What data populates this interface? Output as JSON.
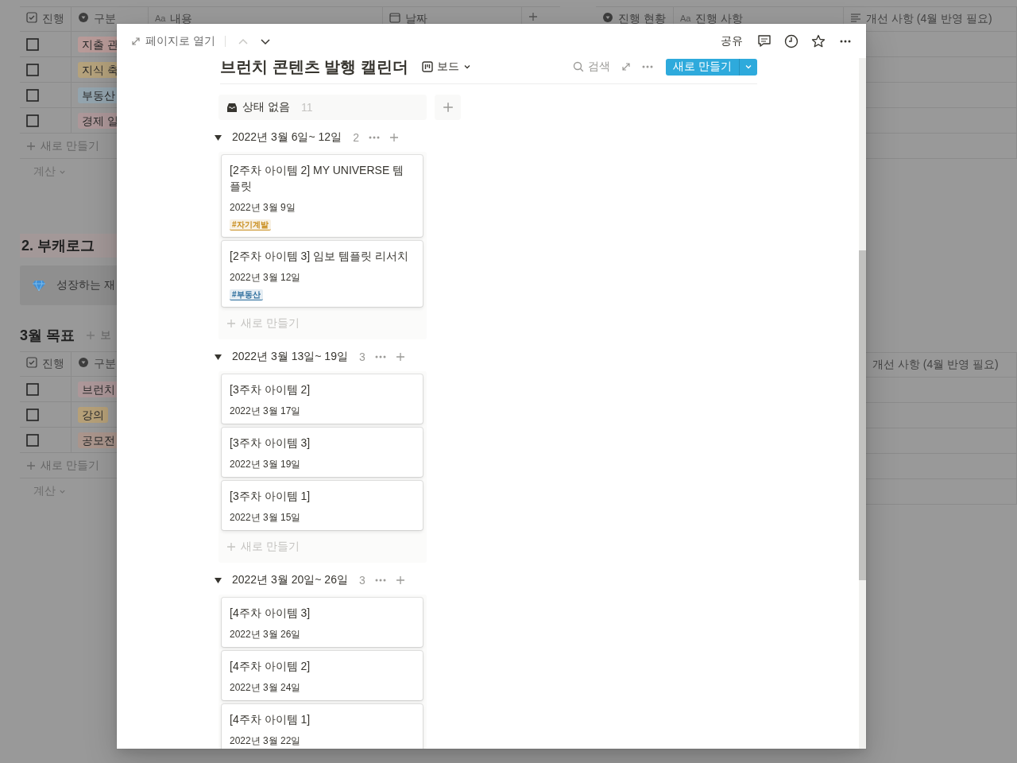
{
  "background": {
    "table_1": {
      "columns": [
        {
          "label": "진행",
          "kind": "checkbox"
        },
        {
          "label": "구분",
          "kind": "select"
        },
        {
          "label": "내용",
          "kind": "title",
          "icon_text": "Aa"
        },
        {
          "label": "날짜",
          "kind": "date"
        }
      ],
      "rows": [
        {
          "checked": false,
          "tag": "지출 관",
          "color": "#b89a98"
        },
        {
          "checked": false,
          "tag": "지식 축",
          "color": "#b5a27c"
        },
        {
          "checked": false,
          "tag": "부동산",
          "color": "#93a4ae"
        },
        {
          "checked": false,
          "tag": "경제 일",
          "color": "#ad9799"
        }
      ],
      "new_row": "새로 만들기",
      "calculate": "계산"
    },
    "heading": "2. 부캐로그",
    "callout": "성장하는 재",
    "table_2_title": "3월 목표",
    "add_view": "보",
    "table_2": {
      "columns": [
        {
          "label": "진행",
          "kind": "checkbox"
        },
        {
          "label": "구분",
          "kind": "select"
        }
      ],
      "rows": [
        {
          "checked": false,
          "tag": "브런치",
          "color": "#ad9799"
        },
        {
          "checked": false,
          "tag": "강의",
          "color": "#b6a078"
        },
        {
          "checked": false,
          "tag": "공모전",
          "color": "#aa958c"
        }
      ],
      "new_row": "새로 만들기",
      "calculate": "계산"
    },
    "table_3": {
      "columns": [
        {
          "label": "진행 현황",
          "kind": "select"
        },
        {
          "label": "진행 사항",
          "kind": "title",
          "icon_text": "Aa"
        },
        {
          "label": "개선 사항 (4월 반영 필요)",
          "kind": "text"
        }
      ]
    },
    "table_4": {
      "columns": [
        {
          "label": "개선 사항 (4월 반영 필요)"
        }
      ]
    }
  },
  "peek": {
    "open_as_page": "페이지로 열기",
    "prev_disabled": true,
    "next_disabled": false,
    "share": "공유",
    "title": "브런치 콘텐츠 발행 캘린더",
    "view": "보드",
    "search": "검색",
    "new_button": "새로 만들기",
    "no_status": {
      "label": "상태 없음",
      "count": "11"
    },
    "groups": [
      {
        "label": "2022년 3월 6일~ 12일",
        "count": "2",
        "expanded": true,
        "new_label": "새로 만들기",
        "cards": [
          {
            "title": "[2주차 아이템 2] MY UNIVERSE 템플릿",
            "date": "2022년 3월 9일",
            "tag": {
              "label": "#자기계발",
              "color": "#c98e1f"
            }
          },
          {
            "title": "[2주차 아이템 3] 임보 템플릿 리서치",
            "date": "2022년 3월 12일",
            "tag": {
              "label": "#부동산",
              "color": "#2b6d9c"
            }
          }
        ]
      },
      {
        "label": "2022년 3월 13일~ 19일",
        "count": "3",
        "expanded": true,
        "new_label": "새로 만들기",
        "cards": [
          {
            "title": "[3주차 아이템 2]",
            "date": "2022년 3월 17일"
          },
          {
            "title": "[3주차 아이템 3]",
            "date": "2022년 3월 19일"
          },
          {
            "title": "[3주차 아이템 1]",
            "date": "2022년 3월 15일"
          }
        ]
      },
      {
        "label": "2022년 3월 20일~ 26일",
        "count": "3",
        "expanded": true,
        "cards": [
          {
            "title": "[4주차 아이템 3]",
            "date": "2022년 3월 26일"
          },
          {
            "title": "[4주차 아이템 2]",
            "date": "2022년 3월 24일"
          },
          {
            "title": "[4주차 아이템 1]",
            "date": "2022년 3월 22일"
          }
        ]
      }
    ]
  }
}
